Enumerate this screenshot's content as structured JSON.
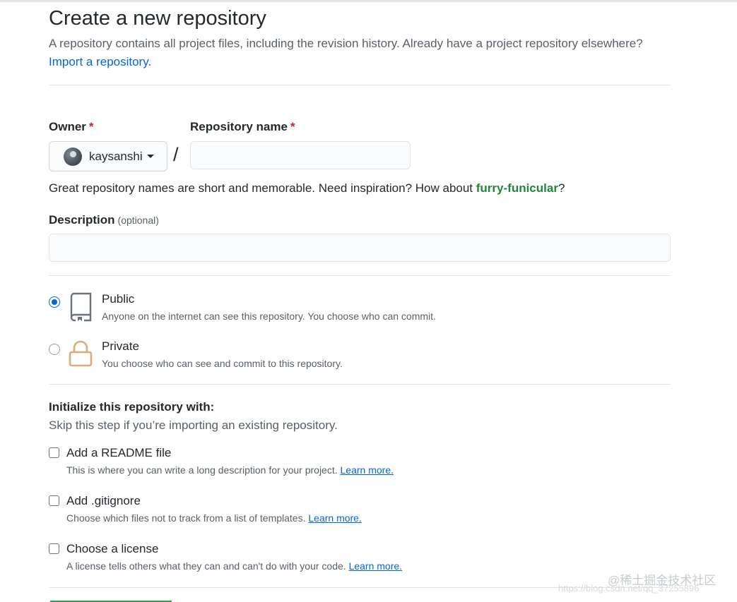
{
  "header": {
    "title": "Create a new repository",
    "subtitle": "A repository contains all project files, including the revision history. Already have a project repository elsewhere?",
    "import_link": "Import a repository."
  },
  "owner": {
    "label": "Owner",
    "required_mark": "*",
    "value": "kaysanshi"
  },
  "separator": "/",
  "repo_name": {
    "label": "Repository name",
    "required_mark": "*",
    "value": ""
  },
  "name_hint": {
    "prefix": "Great repository names are short and memorable. Need inspiration? How about ",
    "suggestion": "furry-funicular",
    "suffix": "?"
  },
  "description": {
    "label": "Description",
    "optional": "(optional)",
    "value": ""
  },
  "visibility": {
    "selected": "public",
    "options": [
      {
        "id": "public",
        "title": "Public",
        "desc": "Anyone on the internet can see this repository. You choose who can commit.",
        "icon": "repo-icon",
        "checked": true
      },
      {
        "id": "private",
        "title": "Private",
        "desc": "You choose who can see and commit to this repository.",
        "icon": "lock-icon",
        "checked": false
      }
    ]
  },
  "init": {
    "title": "Initialize this repository with:",
    "subtitle": "Skip this step if you’re importing an existing repository.",
    "options": [
      {
        "title": "Add a README file",
        "desc": "This is where you can write a long description for your project.",
        "link": "Learn more.",
        "checked": false
      },
      {
        "title": "Add .gitignore",
        "desc": "Choose which files not to track from a list of templates.",
        "link": "Learn more.",
        "checked": false
      },
      {
        "title": "Choose a license",
        "desc": "A license tells others what they can and can't do with your code.",
        "link": "Learn more.",
        "checked": false
      }
    ]
  },
  "watermark": {
    "line1": "@稀土掘金技术社区",
    "line2": "https://blog.csdn.net/qq_37255896"
  },
  "colors": {
    "link": "#0366d6",
    "suggestion": "#22863a",
    "required": "#cb2431",
    "radio_checked": "#0366d6",
    "create_button": "#2ea44f"
  }
}
